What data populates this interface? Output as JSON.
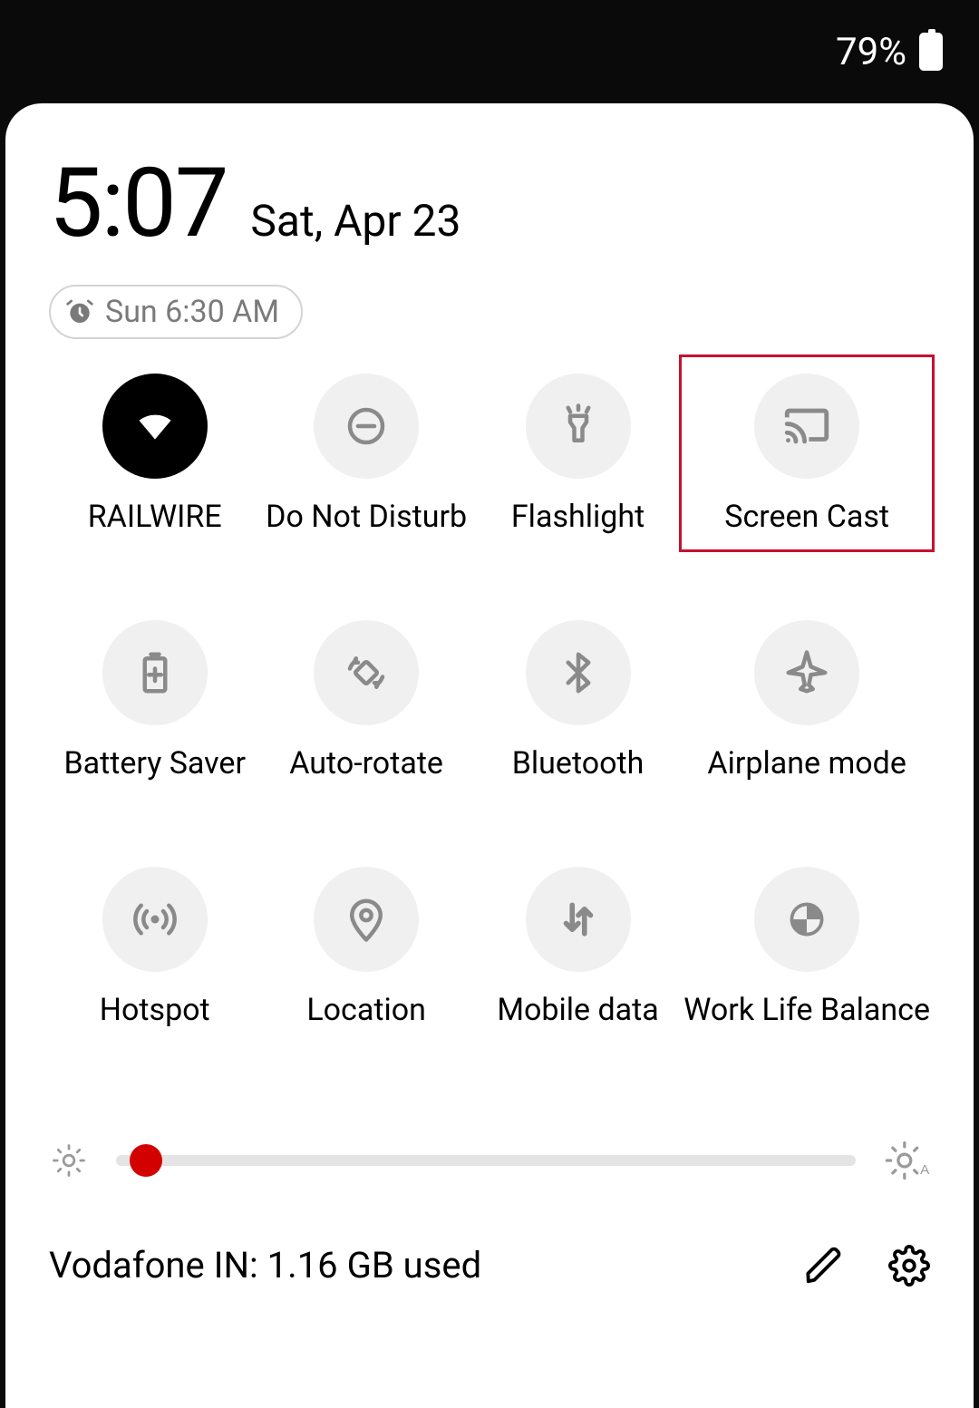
{
  "status": {
    "battery_pct": "79%"
  },
  "clock": {
    "time": "5:07",
    "date": "Sat, Apr 23"
  },
  "alarm": {
    "label": "Sun 6:30 AM"
  },
  "tiles": [
    {
      "label": "RAILWIRE",
      "icon": "wifi",
      "active": true
    },
    {
      "label": "Do Not Disturb",
      "icon": "dnd",
      "active": false
    },
    {
      "label": "Flashlight",
      "icon": "flashlight",
      "active": false
    },
    {
      "label": "Screen Cast",
      "icon": "cast",
      "active": false,
      "highlight": true
    },
    {
      "label": "Battery Saver",
      "icon": "battery",
      "active": false
    },
    {
      "label": "Auto-rotate",
      "icon": "rotate",
      "active": false
    },
    {
      "label": "Bluetooth",
      "icon": "bluetooth",
      "active": false
    },
    {
      "label": "Airplane mode",
      "icon": "airplane",
      "active": false
    },
    {
      "label": "Hotspot",
      "icon": "hotspot",
      "active": false
    },
    {
      "label": "Location",
      "icon": "location",
      "active": false
    },
    {
      "label": "Mobile data",
      "icon": "mobiledata",
      "active": false
    },
    {
      "label": "Work Life Balance",
      "icon": "worklife",
      "active": false
    }
  ],
  "brightness": {
    "value": 4,
    "min": 0,
    "max": 100
  },
  "footer": {
    "data_usage": "Vodafone IN: 1.16 GB used"
  }
}
